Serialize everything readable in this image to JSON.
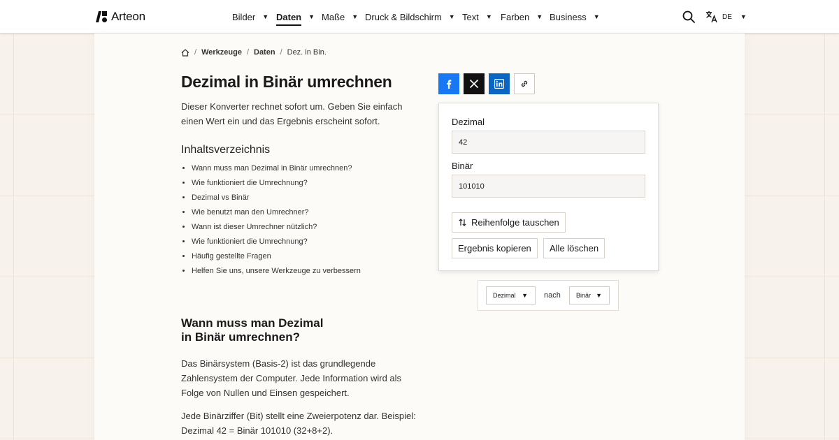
{
  "brand": {
    "name": "Arteon"
  },
  "nav": {
    "items": [
      {
        "label": "Bilder",
        "active": false
      },
      {
        "label": "Daten",
        "active": true
      },
      {
        "label": "Maße",
        "active": false
      },
      {
        "label": "Druck & Bildschirm",
        "active": false
      },
      {
        "label": "Text",
        "active": false
      },
      {
        "label": "Farben",
        "active": false
      },
      {
        "label": "Business",
        "active": false
      }
    ],
    "caret": "▼",
    "language": "DE"
  },
  "breadcrumb": {
    "items": [
      "Werkzeuge",
      "Daten",
      "Dez. in Bin."
    ],
    "separator": "/"
  },
  "page": {
    "title": "Dezimal in Binär umrechnen",
    "intro": "Dieser Konverter rechnet sofort um. Geben Sie einfach einen Wert ein und das Ergebnis erscheint sofort."
  },
  "toc": {
    "title": "Inhaltsverzeichnis",
    "items": [
      "Wann muss man Dezimal in Binär umrechnen?",
      "Wie funktioniert die Umrechnung?",
      "Dezimal vs Binär",
      "Wie benutzt man den Umrechner?",
      "Wann ist dieser Umrechner nützlich?",
      "Wie funktioniert die Umrechnung?",
      "Häufig gestellte Fragen",
      "Helfen Sie uns, unsere Werkzeuge zu verbessern"
    ]
  },
  "section": {
    "title_line1": "Wann muss man Dezimal",
    "title_line2": "in Binär umrechnen?",
    "para1": "Das Binärsystem (Basis-2) ist das grundlegende Zahlensystem der Computer. Jede Information wird als Folge von Nullen und Einsen gespeichert.",
    "para2": "Jede Binärziffer (Bit) stellt eine Zweierpotenz dar. Beispiel: Dezimal 42 = Binär 101010 (32+8+2)."
  },
  "converter": {
    "input_label": "Dezimal",
    "input_value": "42",
    "output_label": "Binär",
    "output_value": "101010",
    "swap_label": "Reihenfolge tauschen",
    "copy_label": "Ergebnis kopieren",
    "clear_label": "Alle löschen"
  },
  "units": {
    "from": "Dezimal",
    "connector": "nach",
    "to": "Binär",
    "caret": "▼"
  },
  "colors": {
    "facebook": "#1877f2",
    "x": "#111111",
    "linkedin": "#0a66c2"
  }
}
